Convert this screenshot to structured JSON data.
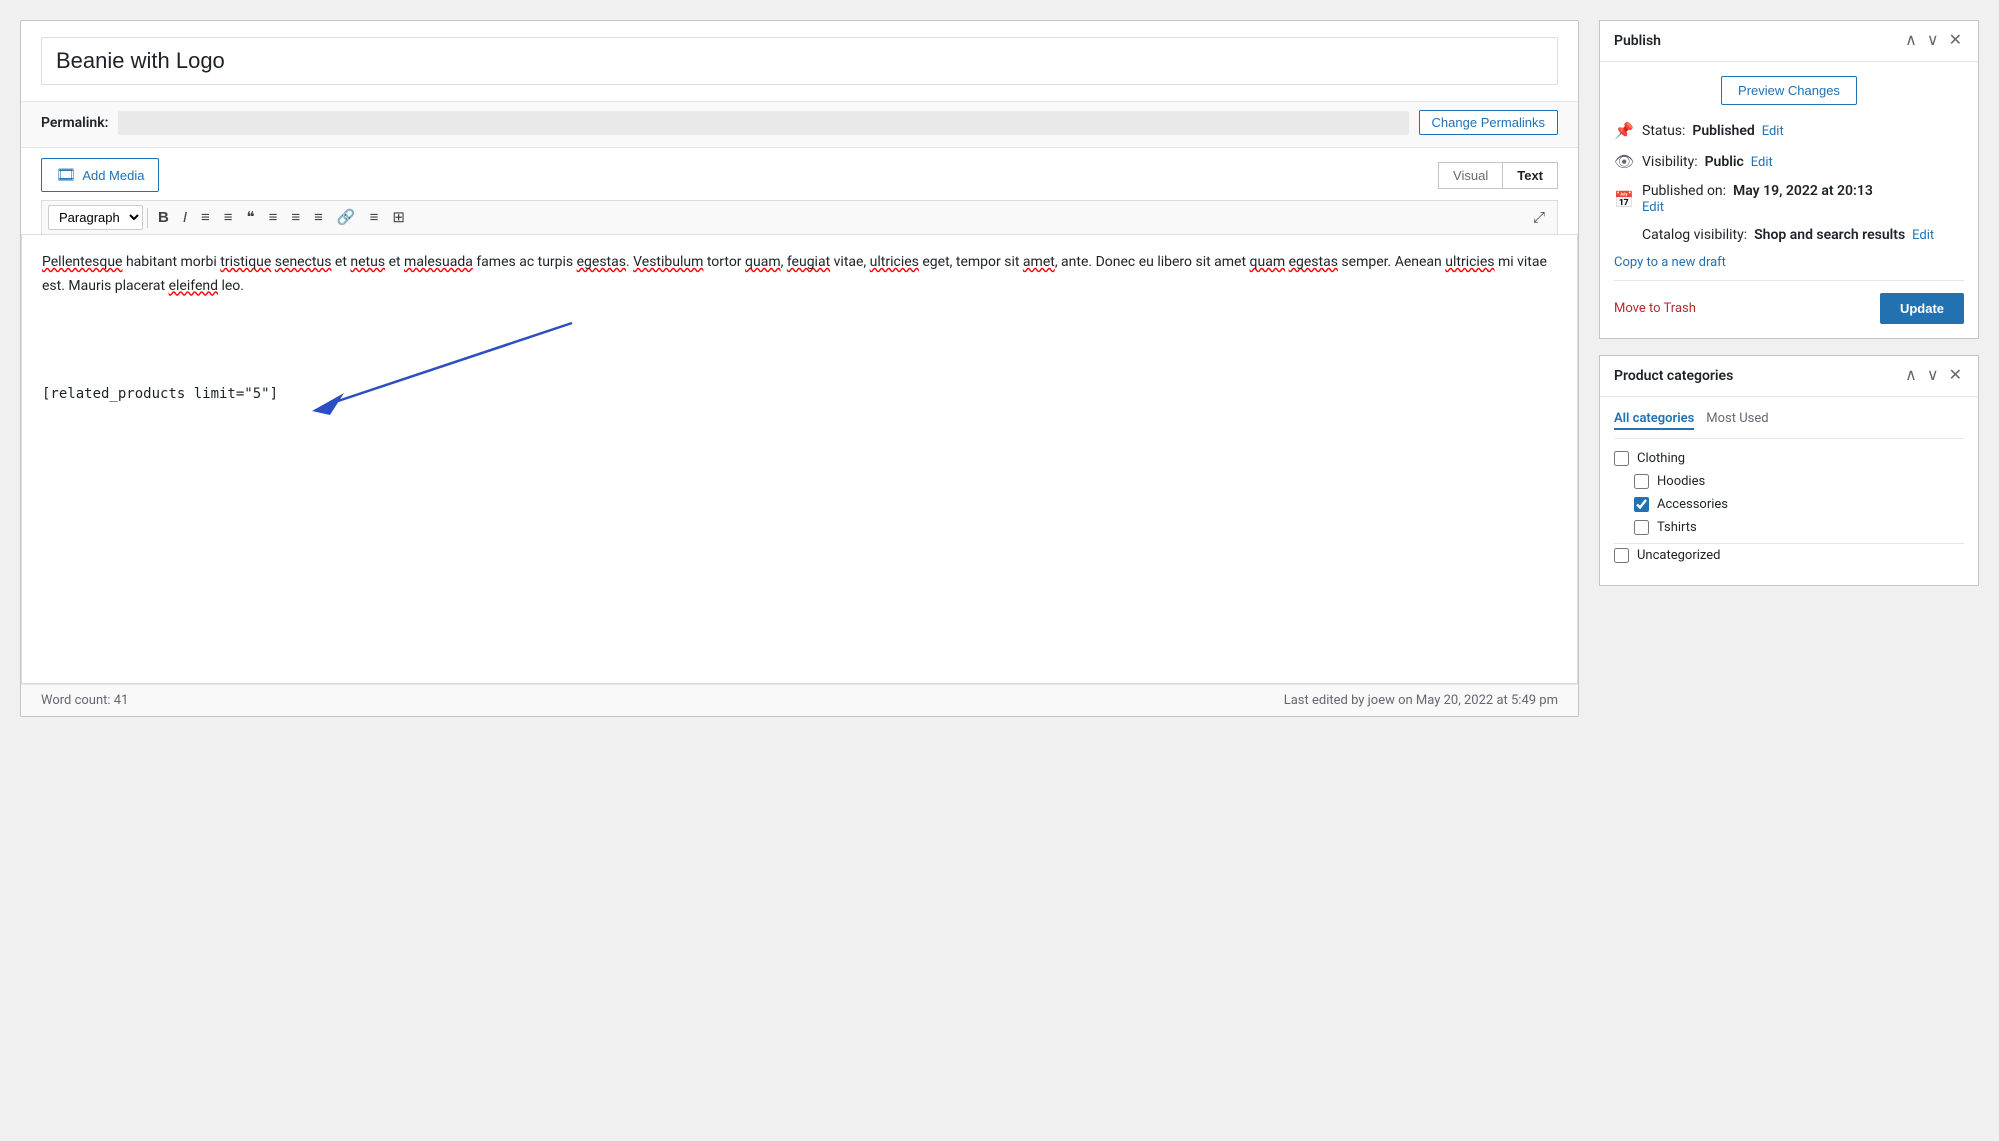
{
  "editor": {
    "title": "Beanie with Logo",
    "permalink_label": "Permalink:",
    "change_permalinks_label": "Change Permalinks",
    "add_media_label": "Add Media",
    "visual_tab": "Visual",
    "text_tab": "Text",
    "paragraph_select": "Paragraph",
    "toolbar_buttons": [
      "B",
      "I",
      "≡",
      "≡",
      "❝",
      "≡",
      "≡",
      "≡",
      "🔗",
      "≡",
      "⊞"
    ],
    "content_text": "Pellentesque habitant morbi tristique senectus et netus et malesuada fames ac turpis egestas. Vestibulum tortor quam, feugiat vitae, ultricies eget, tempor sit amet, ante. Donec eu libero sit amet quam egestas semper. Aenean ultricies mi vitae est. Mauris placerat eleifend leo.",
    "shortcode": "[related_products limit=\"5\"]",
    "word_count_label": "Word count:",
    "word_count": "41",
    "last_edited": "Last edited by joew on May 20, 2022 at 5:49 pm"
  },
  "publish_panel": {
    "title": "Publish",
    "preview_changes_label": "Preview Changes",
    "status_label": "Status:",
    "status_value": "Published",
    "status_edit": "Edit",
    "visibility_label": "Visibility:",
    "visibility_value": "Public",
    "visibility_edit": "Edit",
    "published_on_label": "Published on:",
    "published_on_value": "May 19, 2022 at 20:13",
    "published_edit": "Edit",
    "catalog_visibility_label": "Catalog visibility:",
    "catalog_visibility_value": "Shop and search results",
    "catalog_visibility_edit": "Edit",
    "copy_draft_label": "Copy to a new draft",
    "move_trash_label": "Move to Trash",
    "update_label": "Update"
  },
  "product_categories_panel": {
    "title": "Product categories",
    "tab_all": "All categories",
    "tab_most_used": "Most Used",
    "categories": [
      {
        "label": "Clothing",
        "checked": false,
        "level": 0
      },
      {
        "label": "Hoodies",
        "checked": false,
        "level": 1
      },
      {
        "label": "Accessories",
        "checked": true,
        "level": 1
      },
      {
        "label": "Tshirts",
        "checked": false,
        "level": 1
      },
      {
        "label": "Uncategorized",
        "checked": false,
        "level": 0
      }
    ]
  },
  "icons": {
    "up_arrow": "∧",
    "down_arrow": "∨",
    "close": "✕",
    "pin": "📌",
    "eye": "👁",
    "calendar": "📅",
    "media": "🎞"
  }
}
